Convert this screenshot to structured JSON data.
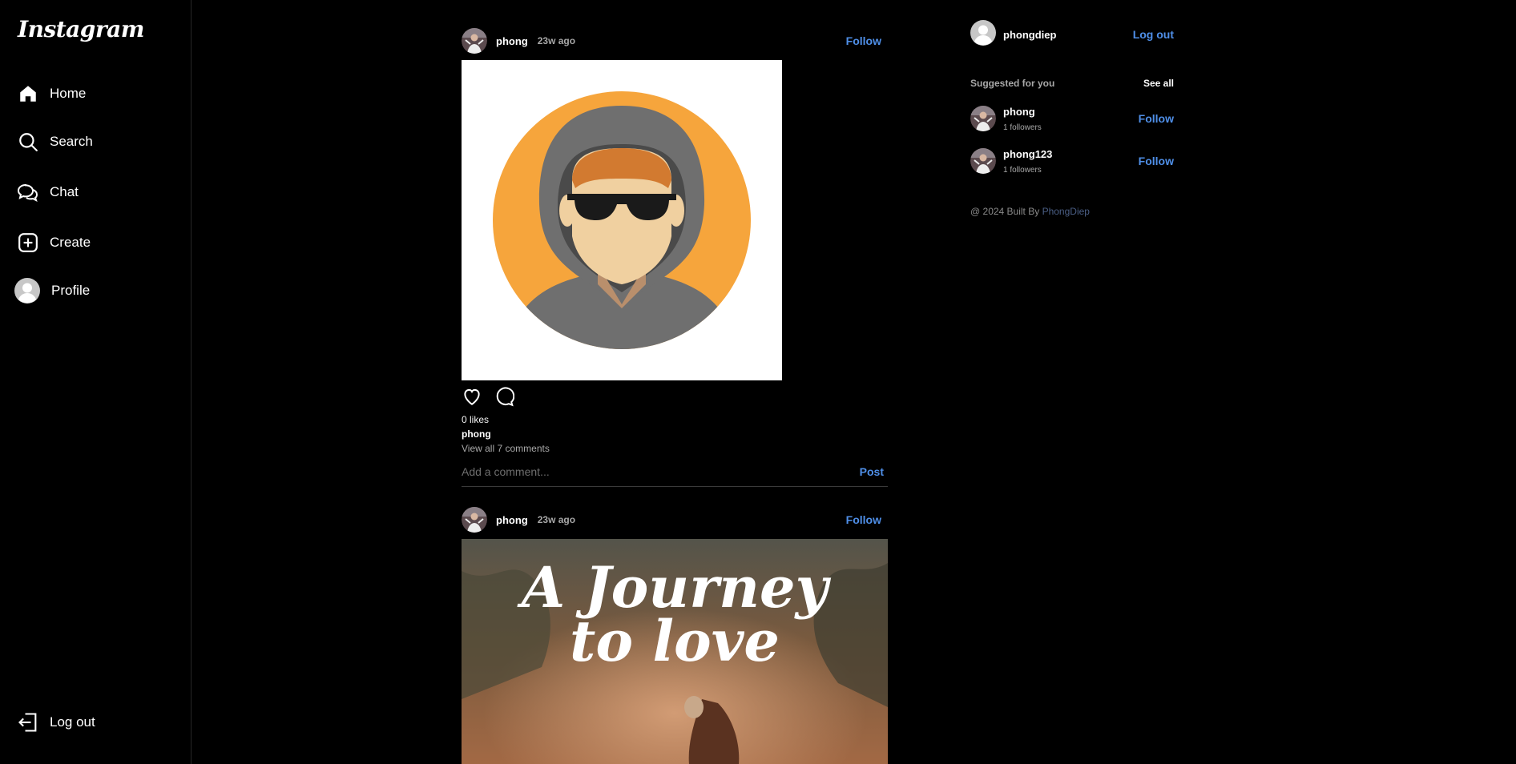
{
  "app": {
    "logo_text": "Instagram"
  },
  "sidebar": {
    "items": [
      {
        "label": "Home",
        "icon": "home-icon"
      },
      {
        "label": "Search",
        "icon": "search-icon"
      },
      {
        "label": "Chat",
        "icon": "chat-icon"
      },
      {
        "label": "Create",
        "icon": "plus-square-icon"
      },
      {
        "label": "Profile",
        "icon": "avatar-icon"
      }
    ],
    "logout_label": "Log out"
  },
  "feed": {
    "posts": [
      {
        "username": "phong",
        "time": "23w ago",
        "follow_label": "Follow",
        "likes": "0 likes",
        "caption_user": "phong",
        "view_comments": "View all 7 comments",
        "comment_placeholder": "Add a comment...",
        "post_label": "Post"
      },
      {
        "username": "phong",
        "time": "23w ago",
        "follow_label": "Follow",
        "image_title_line1": "A Journey",
        "image_title_line2": "to love"
      }
    ]
  },
  "right_panel": {
    "current_user": "phongdiep",
    "logout_label": "Log out",
    "suggested_title": "Suggested for you",
    "see_all_label": "See all",
    "suggestions": [
      {
        "username": "phong",
        "followers": "1 followers",
        "follow_label": "Follow"
      },
      {
        "username": "phong123",
        "followers": "1 followers",
        "follow_label": "Follow"
      }
    ],
    "footer_prefix": "@ 2024 Built By",
    "footer_link": "PhongDiep"
  },
  "colors": {
    "background": "#000000",
    "accent": "#4f8fe8",
    "muted": "#a8a8a8",
    "avatar_orange": "#f6a53c",
    "hood_gray": "#6f6f6f"
  }
}
